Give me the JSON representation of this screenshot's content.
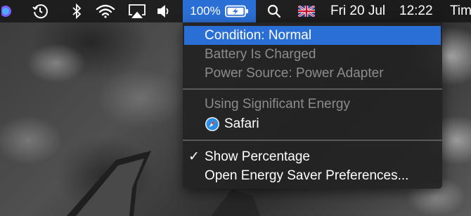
{
  "menubar": {
    "battery_percent": "100%",
    "date": "Fri 20 Jul",
    "time": "12:22",
    "trailing_text": "Tim"
  },
  "battery_menu": {
    "condition": "Condition: Normal",
    "charged_status": "Battery Is Charged",
    "power_source": "Power Source: Power Adapter",
    "energy_header": "Using Significant Energy",
    "energy_apps": [
      {
        "name": "Safari",
        "icon": "safari-icon"
      }
    ],
    "show_percentage_check": "✓",
    "show_percentage": "Show Percentage",
    "open_prefs": "Open Energy Saver Preferences..."
  },
  "colors": {
    "highlight": "#2a6fd6",
    "menu_bg": "#222222",
    "disabled_text": "#8c8c8c"
  }
}
